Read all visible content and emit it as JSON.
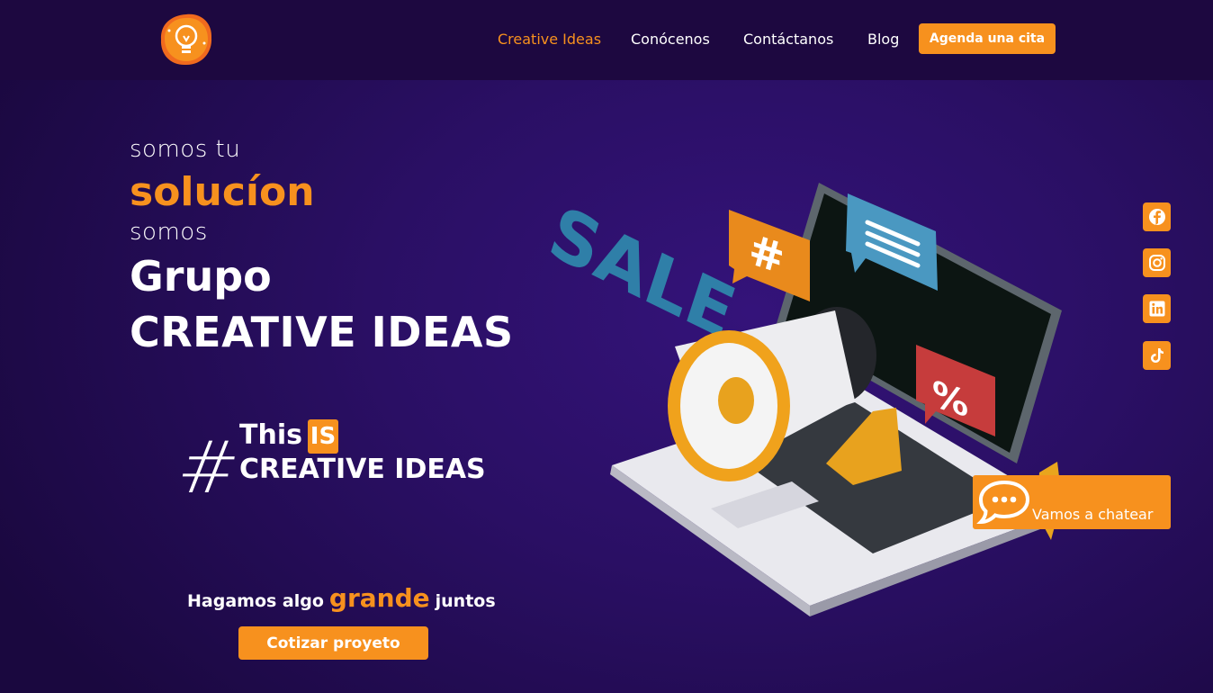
{
  "nav": {
    "items": [
      {
        "label": "Creative Ideas",
        "active": true
      },
      {
        "label": "Conócenos"
      },
      {
        "label": "Contáctanos"
      },
      {
        "label": "Blog"
      }
    ],
    "cta_label": "Agenda una cita"
  },
  "hero": {
    "line1": "somos tu",
    "line2": "solucíon",
    "line3": "somos",
    "line4": "Grupo",
    "line5": "CREATIVE IDEAS"
  },
  "tagline": {
    "hash": "#",
    "this": "This",
    "is": "IS",
    "brand": "CREATIVE IDEAS"
  },
  "callout": {
    "pre": "Hagamos algo",
    "emphasis": "grande",
    "post": "juntos",
    "button": "Cotizar proyeto"
  },
  "illustration": {
    "sale_text": "SALE",
    "bubble_hash": "#",
    "bubble_percent": "%"
  },
  "social": [
    "facebook-icon",
    "instagram-icon",
    "linkedin-icon",
    "tiktok-icon"
  ],
  "chat": {
    "label": "Vamos a chatear"
  },
  "colors": {
    "accent": "#f7911e",
    "header": "#1d0840",
    "background": "#2a0f64"
  }
}
